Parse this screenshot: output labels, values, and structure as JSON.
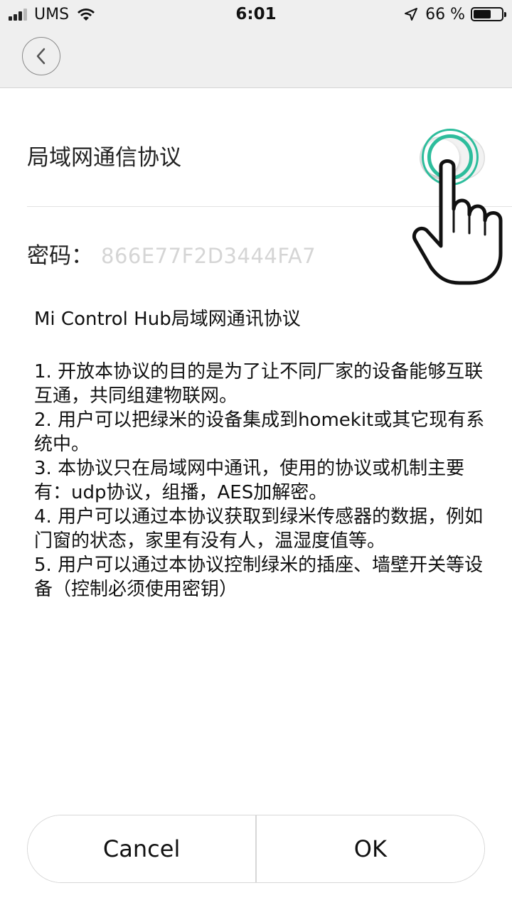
{
  "status_bar": {
    "carrier": "UMS",
    "time": "6:01",
    "battery_percent": "66 %",
    "battery_level": 0.66,
    "icons": [
      "signal-icon",
      "wifi-icon",
      "location-arrow-icon",
      "battery-icon"
    ]
  },
  "nav": {
    "back_icon": "chevron-left-icon"
  },
  "setting": {
    "label": "局域网通信协议",
    "toggle_on": false
  },
  "password": {
    "label": "密码：",
    "value": "866E77F2D3444FA7"
  },
  "protocol": {
    "title": "Mi Control Hub局域网通讯协议",
    "items": [
      "1. 开放本协议的目的是为了让不同厂家的设备能够互联互通，共同组建物联网。",
      "2. 用户可以把绿米的设备集成到homekit或其它现有系统中。",
      "3. 本协议只在局域网中通讯，使用的协议或机制主要有：udp协议，组播，AES加解密。",
      "4. 用户可以通过本协议获取到绿米传感器的数据，例如门窗的状态，家里有没有人，温湿度值等。",
      "5. 用户可以通过本协议控制绿米的插座、墙壁开关等设备（控制必须使用密钥）"
    ]
  },
  "dialog": {
    "cancel_label": "Cancel",
    "ok_label": "OK"
  },
  "colors": {
    "accent_touch": "#2dbd9c",
    "nav_background": "#efefef",
    "password_text": "#d5d5d5"
  }
}
